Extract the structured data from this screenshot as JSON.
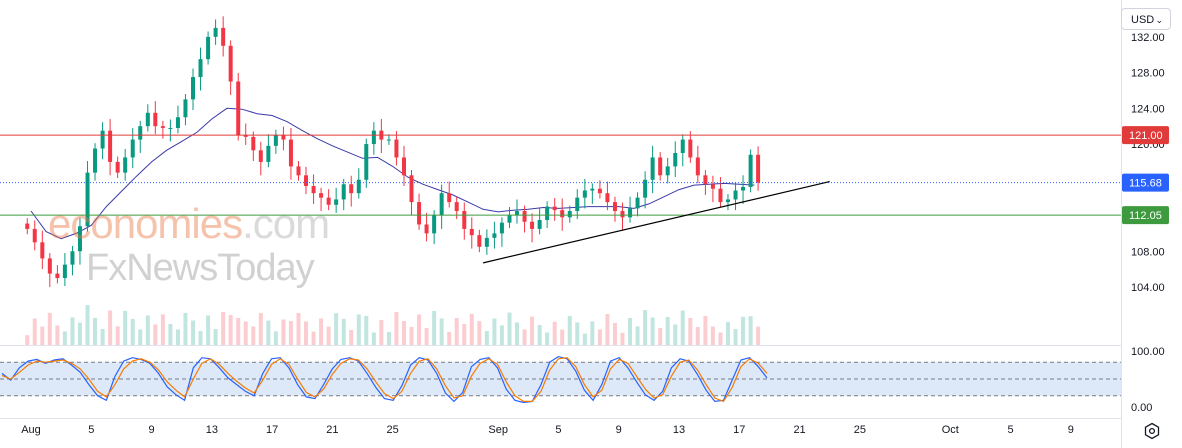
{
  "toolbar": {
    "currency": "USD"
  },
  "watermark": {
    "brand_part1": "economies",
    "brand_part2": ".com",
    "secondary": "FxNewsToday"
  },
  "colors": {
    "bull": "#089981",
    "bear": "#f23645",
    "ma_line": "#3a3aa8",
    "resistance": "#e03a3a",
    "support": "#3e9a3e",
    "current": "#2962ff",
    "stoch_k": "#2962ff",
    "stoch_d": "#f57c00",
    "stoch_band": "#dde8f8"
  },
  "chart_data": [
    {
      "type": "candlestick",
      "price_axis": {
        "ticks": [
          "132.00",
          "128.00",
          "124.00",
          "120.00",
          "108.00",
          "104.00"
        ],
        "ylim": [
          101.2,
          135.9
        ]
      },
      "time_axis": {
        "labels": [
          "Aug",
          "5",
          "9",
          "13",
          "17",
          "21",
          "25",
          "Sep",
          "5",
          "9",
          "13",
          "17",
          "21",
          "25",
          "Oct",
          "5",
          "9"
        ],
        "start": "Aug 1",
        "end": "Oct 12"
      },
      "price_markers": [
        {
          "label": "121.00",
          "value": 121.0,
          "style": "horizontal-line",
          "role": "resistance"
        },
        {
          "label": "115.68",
          "value": 115.68,
          "style": "dotted-line",
          "role": "current"
        },
        {
          "label": "112.05",
          "value": 112.05,
          "style": "horizontal-line",
          "role": "support"
        }
      ],
      "trendline": {
        "from": {
          "date": "Aug 31",
          "price": 106.7
        },
        "to": {
          "date": "Sep 23",
          "price": 115.8
        }
      },
      "moving_average_points": [
        [
          "Aug 1",
          112.5
        ],
        [
          "Aug 2",
          110.2
        ],
        [
          "Aug 3",
          109.4
        ],
        [
          "Aug 4",
          110.0
        ],
        [
          "Aug 5",
          110.9
        ],
        [
          "Aug 6",
          113.0
        ],
        [
          "Aug 7",
          114.7
        ],
        [
          "Aug 8",
          116.4
        ],
        [
          "Aug 9",
          118.0
        ],
        [
          "Aug 10",
          119.3
        ],
        [
          "Aug 11",
          120.3
        ],
        [
          "Aug 12",
          121.3
        ],
        [
          "Aug 13",
          122.8
        ],
        [
          "Aug 14",
          124.0
        ],
        [
          "Aug 15",
          123.9
        ],
        [
          "Aug 16",
          123.4
        ],
        [
          "Aug 17",
          123.2
        ],
        [
          "Aug 18",
          122.5
        ],
        [
          "Aug 19",
          121.5
        ],
        [
          "Aug 20",
          120.6
        ],
        [
          "Aug 21",
          119.8
        ],
        [
          "Aug 22",
          119.1
        ],
        [
          "Aug 23",
          118.4
        ],
        [
          "Aug 24",
          118.5
        ],
        [
          "Aug 25",
          117.5
        ],
        [
          "Aug 26",
          116.3
        ],
        [
          "Aug 27",
          115.5
        ],
        [
          "Aug 28",
          114.9
        ],
        [
          "Aug 29",
          114.3
        ],
        [
          "Aug 30",
          113.5
        ],
        [
          "Aug 31",
          112.7
        ],
        [
          "Sep 1",
          112.4
        ],
        [
          "Sep 2",
          112.6
        ],
        [
          "Sep 3",
          112.7
        ],
        [
          "Sep 4",
          112.9
        ],
        [
          "Sep 5",
          112.8
        ],
        [
          "Sep 6",
          112.9
        ],
        [
          "Sep 7",
          113.0
        ],
        [
          "Sep 8",
          113.0
        ],
        [
          "Sep 9",
          113.0
        ],
        [
          "Sep 10",
          112.8
        ],
        [
          "Sep 11",
          113.3
        ],
        [
          "Sep 12",
          114.1
        ],
        [
          "Sep 13",
          114.9
        ],
        [
          "Sep 14",
          115.4
        ],
        [
          "Sep 15",
          115.5
        ],
        [
          "Sep 16",
          115.6
        ],
        [
          "Sep 17",
          115.5
        ],
        [
          "Sep 18",
          115.4
        ]
      ],
      "candles_close": [
        [
          "Aug 1",
          110.5
        ],
        [
          "Aug 1",
          109.0
        ],
        [
          "Aug 2",
          107.2
        ],
        [
          "Aug 2",
          105.5
        ],
        [
          "Aug 3",
          105.0
        ],
        [
          "Aug 3",
          106.5
        ],
        [
          "Aug 4",
          108.0
        ],
        [
          "Aug 4",
          110.8
        ],
        [
          "Aug 5",
          116.8
        ],
        [
          "Aug 5",
          119.5
        ],
        [
          "Aug 6",
          121.5
        ],
        [
          "Aug 6",
          118.0
        ],
        [
          "Aug 7",
          116.8
        ],
        [
          "Aug 7",
          118.5
        ],
        [
          "Aug 8",
          120.5
        ],
        [
          "Aug 8",
          122.0
        ],
        [
          "Aug 9",
          123.5
        ],
        [
          "Aug 9",
          122.0
        ],
        [
          "Aug 10",
          121.8
        ],
        [
          "Aug 10",
          121.8
        ],
        [
          "Aug 11",
          123.0
        ],
        [
          "Aug 11",
          125.0
        ],
        [
          "Aug 12",
          127.5
        ],
        [
          "Aug 12",
          129.5
        ],
        [
          "Aug 13",
          132.0
        ],
        [
          "Aug 13",
          133.0
        ],
        [
          "Aug 14",
          131.0
        ],
        [
          "Aug 14",
          127.0
        ],
        [
          "Aug 15",
          121.0
        ],
        [
          "Aug 15",
          120.8
        ],
        [
          "Aug 16",
          119.3
        ],
        [
          "Aug 16",
          118.0
        ],
        [
          "Aug 17",
          119.8
        ],
        [
          "Aug 17",
          121.0
        ],
        [
          "Aug 18",
          120.5
        ],
        [
          "Aug 18",
          117.5
        ],
        [
          "Aug 19",
          116.5
        ],
        [
          "Aug 19",
          115.3
        ],
        [
          "Aug 20",
          114.5
        ],
        [
          "Aug 20",
          114.0
        ],
        [
          "Aug 21",
          113.2
        ],
        [
          "Aug 21",
          113.8
        ],
        [
          "Aug 22",
          115.5
        ],
        [
          "Aug 22",
          114.5
        ],
        [
          "Aug 23",
          116.0
        ],
        [
          "Aug 23",
          120.0
        ],
        [
          "Aug 24",
          121.5
        ],
        [
          "Aug 24",
          120.5
        ],
        [
          "Aug 25",
          120.5
        ],
        [
          "Aug 25",
          118.5
        ],
        [
          "Aug 26",
          116.5
        ],
        [
          "Aug 26",
          113.5
        ],
        [
          "Aug 27",
          111.0
        ],
        [
          "Aug 27",
          110.0
        ],
        [
          "Aug 28",
          112.0
        ],
        [
          "Aug 28",
          114.5
        ],
        [
          "Aug 29",
          113.5
        ],
        [
          "Aug 29",
          112.5
        ],
        [
          "Aug 30",
          110.5
        ],
        [
          "Aug 30",
          109.8
        ],
        [
          "Aug 31",
          108.5
        ],
        [
          "Aug 31",
          109.5
        ],
        [
          "Sep 1",
          110.0
        ],
        [
          "Sep 1",
          111.2
        ],
        [
          "Sep 2",
          112.0
        ],
        [
          "Sep 2",
          112.5
        ],
        [
          "Sep 3",
          111.3
        ],
        [
          "Sep 3",
          110.5
        ],
        [
          "Sep 4",
          111.5
        ],
        [
          "Sep 4",
          113.0
        ],
        [
          "Sep 5",
          112.6
        ],
        [
          "Sep 5",
          111.8
        ],
        [
          "Sep 6",
          112.5
        ],
        [
          "Sep 6",
          114.0
        ],
        [
          "Sep 7",
          114.8
        ],
        [
          "Sep 7",
          115.0
        ],
        [
          "Sep 8",
          114.5
        ],
        [
          "Sep 8",
          113.5
        ],
        [
          "Sep 9",
          112.5
        ],
        [
          "Sep 9",
          111.8
        ],
        [
          "Sep 10",
          112.8
        ],
        [
          "Sep 10",
          114.0
        ],
        [
          "Sep 11",
          116.0
        ],
        [
          "Sep 11",
          118.5
        ],
        [
          "Sep 12",
          116.5
        ],
        [
          "Sep 12",
          117.5
        ],
        [
          "Sep 13",
          119.0
        ],
        [
          "Sep 13",
          120.5
        ],
        [
          "Sep 14",
          118.5
        ],
        [
          "Sep 14",
          116.5
        ],
        [
          "Sep 15",
          115.5
        ],
        [
          "Sep 15",
          115.0
        ],
        [
          "Sep 16",
          113.5
        ],
        [
          "Sep 16",
          113.8
        ],
        [
          "Sep 17",
          114.8
        ],
        [
          "Sep 17",
          115.2
        ],
        [
          "Sep 18",
          118.8
        ],
        [
          "Sep 18",
          115.68
        ]
      ]
    },
    {
      "type": "line",
      "title": "",
      "ylim": [
        0,
        100
      ],
      "tick_labels": [
        "100.00",
        "0.00"
      ],
      "band": [
        20,
        80
      ],
      "series": [
        {
          "values": [
            60,
            48,
            70,
            82,
            85,
            78,
            84,
            86,
            75,
            62,
            40,
            20,
            12,
            55,
            82,
            88,
            85,
            78,
            60,
            36,
            22,
            12,
            70,
            88,
            86,
            70,
            52,
            40,
            28,
            20,
            60,
            86,
            88,
            70,
            40,
            18,
            15,
            40,
            68,
            85,
            88,
            82,
            60,
            35,
            15,
            12,
            38,
            75,
            88,
            84,
            60,
            25,
            10,
            26,
            72,
            85,
            88,
            70,
            32,
            12,
            8,
            10,
            40,
            80,
            90,
            86,
            64,
            30,
            12,
            40,
            82,
            88,
            70,
            45,
            22,
            12,
            28,
            70,
            86,
            82,
            58,
            30,
            10,
            12,
            48,
            84,
            88,
            72,
            52
          ]
        },
        {
          "values": [
            56,
            50,
            62,
            75,
            82,
            80,
            82,
            84,
            78,
            68,
            50,
            28,
            18,
            40,
            68,
            82,
            86,
            80,
            66,
            45,
            30,
            18,
            50,
            78,
            86,
            76,
            60,
            46,
            34,
            25,
            48,
            76,
            86,
            76,
            50,
            26,
            18,
            32,
            58,
            78,
            86,
            84,
            68,
            45,
            24,
            15,
            28,
            60,
            82,
            86,
            68,
            38,
            16,
            20,
            55,
            78,
            86,
            76,
            45,
            20,
            10,
            10,
            28,
            66,
            86,
            88,
            72,
            40,
            18,
            30,
            68,
            85,
            78,
            55,
            32,
            16,
            22,
            55,
            80,
            84,
            66,
            40,
            16,
            10,
            35,
            72,
            86,
            78,
            60
          ]
        }
      ]
    }
  ]
}
